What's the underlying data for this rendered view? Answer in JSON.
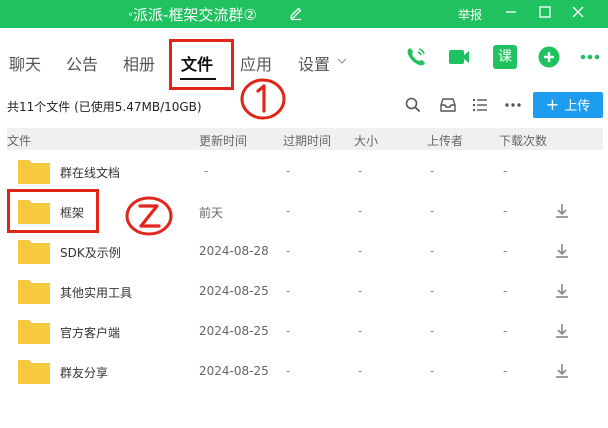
{
  "titlebar": {
    "prefix": "°",
    "title": "派派-框架交流群",
    "badge": "②",
    "report": "举报"
  },
  "tabs": [
    {
      "label": "聊天"
    },
    {
      "label": "公告"
    },
    {
      "label": "相册"
    },
    {
      "label": "文件"
    },
    {
      "label": "应用"
    },
    {
      "label": "设置"
    }
  ],
  "header_icons": {
    "course_label": "课"
  },
  "toolbar": {
    "summary": "共11个文件 (已使用5.47MB/10GB)",
    "upload_label": "上传"
  },
  "table": {
    "columns": [
      "文件",
      "更新时间",
      "过期时间",
      "大小",
      "上传者",
      "下载次数"
    ],
    "rows": [
      {
        "name": "群在线文档",
        "updated": "-",
        "expires": "-",
        "size": "-",
        "uploader": "-",
        "downloads": "-"
      },
      {
        "name": "框架",
        "updated": "前天",
        "expires": "-",
        "size": "-",
        "uploader": "-",
        "downloads": "-"
      },
      {
        "name": "SDK及示例",
        "updated": "2024-08-28",
        "expires": "-",
        "size": "-",
        "uploader": "-",
        "downloads": "-"
      },
      {
        "name": "其他实用工具",
        "updated": "2024-08-25",
        "expires": "-",
        "size": "-",
        "uploader": "-",
        "downloads": "-"
      },
      {
        "name": "官方客户端",
        "updated": "2024-08-25",
        "expires": "-",
        "size": "-",
        "uploader": "-",
        "downloads": "-"
      },
      {
        "name": "群友分享",
        "updated": "2024-08-25",
        "expires": "-",
        "size": "-",
        "uploader": "-",
        "downloads": "-"
      }
    ]
  },
  "colors": {
    "brand": "#20c15f",
    "accent": "#1e9cf0",
    "annotation": "#e1251b",
    "folder": "#f7c93f"
  },
  "icons": [
    "edit-icon",
    "minimize-icon",
    "maximize-icon",
    "close-icon",
    "phone-icon",
    "video-icon",
    "course-icon",
    "add-icon",
    "more-icon",
    "search-icon",
    "inbox-icon",
    "list-view-icon",
    "folder-icon",
    "download-icon"
  ]
}
